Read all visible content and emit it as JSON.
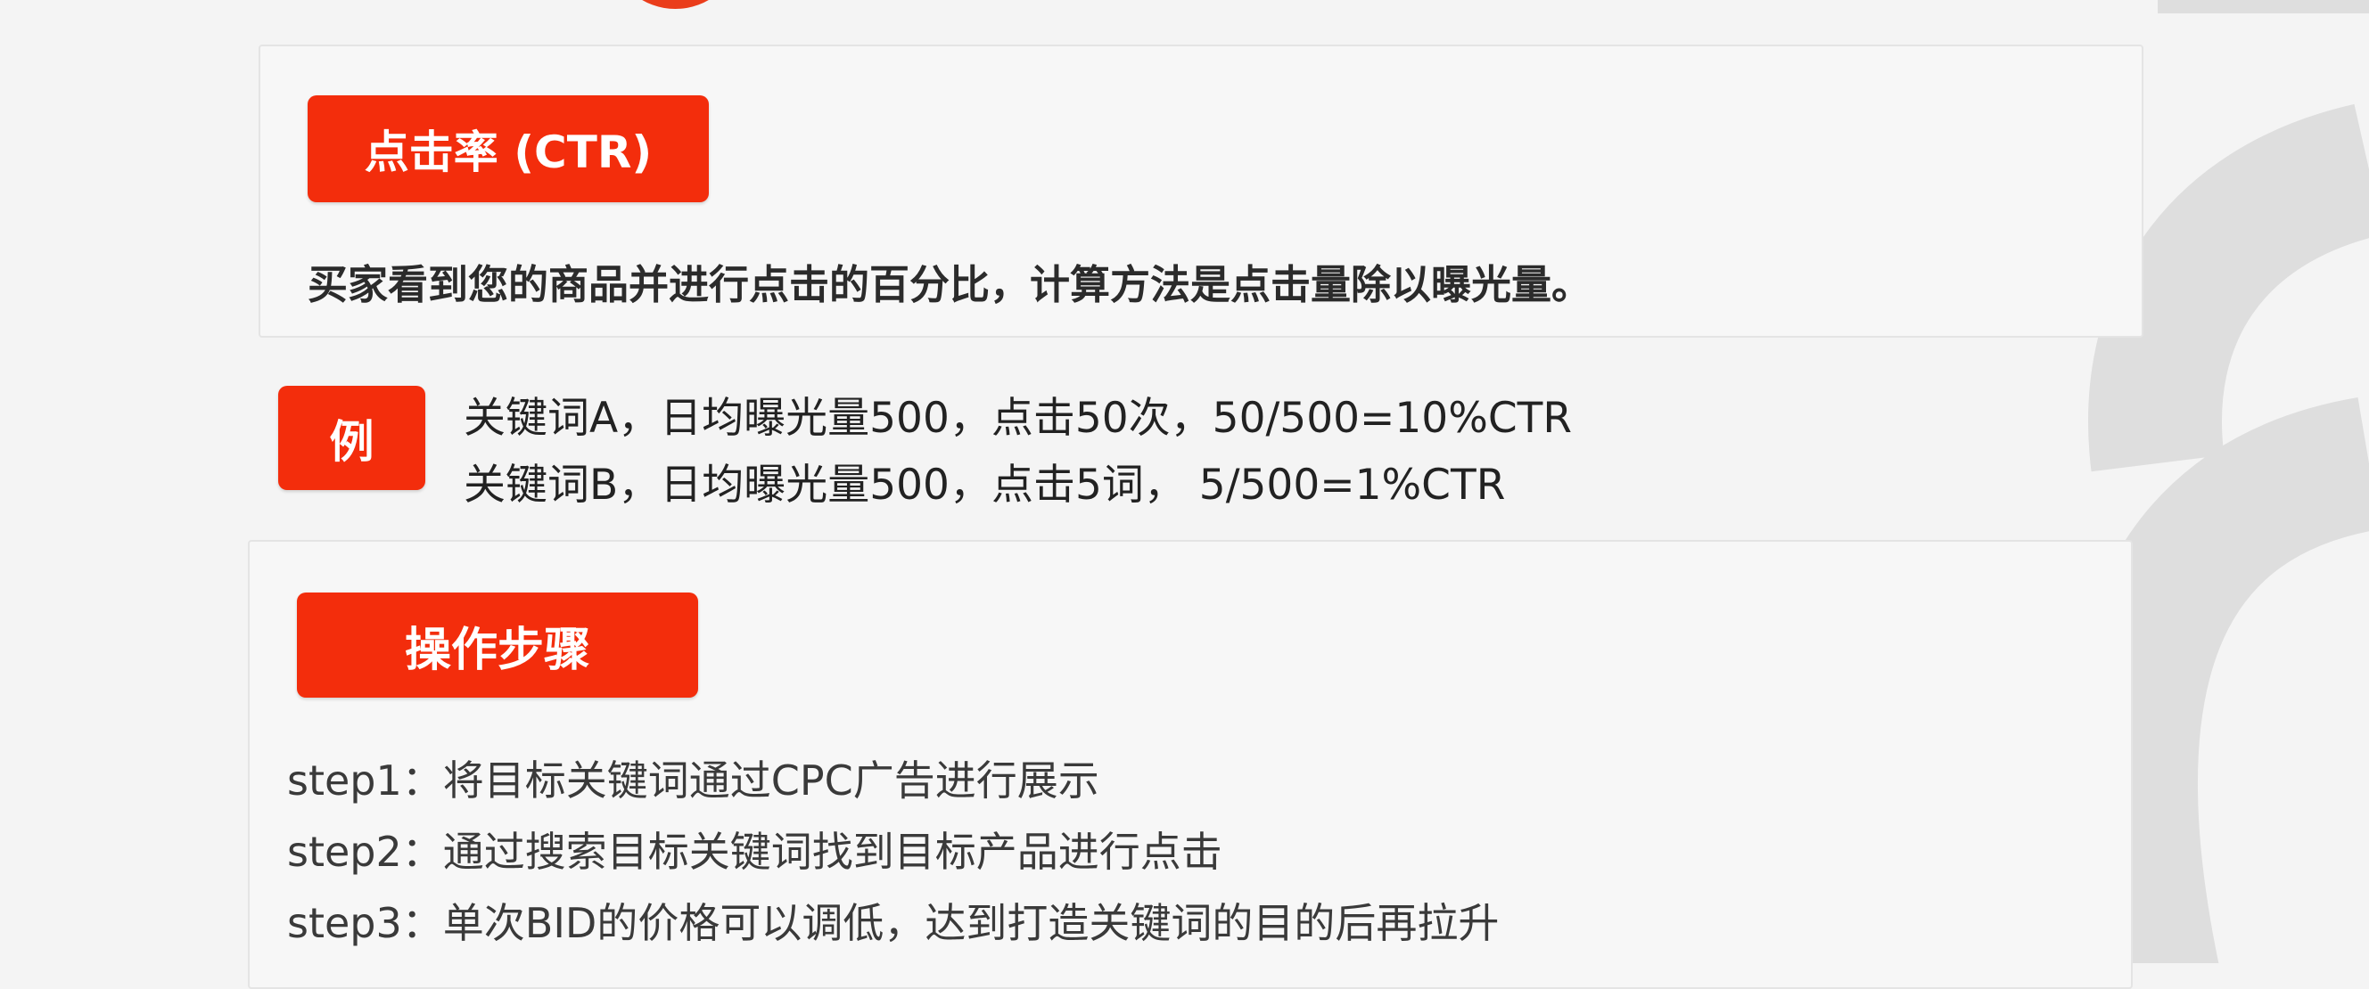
{
  "colors": {
    "accent": "#f32d0c",
    "panel_background": "#f7f7f7",
    "page_background": "#f4f4f4",
    "watermark": "#dcdcdc"
  },
  "ctr_section": {
    "label": "点击率 (CTR)",
    "definition": "买家看到您的商品并进行点击的百分比，计算方法是点击量除以曝光量。"
  },
  "example_section": {
    "label": "例",
    "lines": [
      "关键词A，日均曝光量500，点击50次，50/500=10%CTR",
      "关键词B，日均曝光量500，点击5词，    5/500=1%CTR"
    ]
  },
  "steps_section": {
    "label": "操作步骤",
    "steps": [
      "step1：将目标关键词通过CPC广告进行展示",
      "step2：通过搜索目标关键词找到目标产品进行点击",
      "step3：单次BID的价格可以调低，达到打造关键词的目的后再拉升"
    ]
  }
}
